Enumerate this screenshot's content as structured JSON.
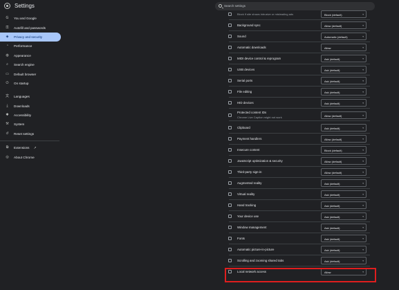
{
  "app": {
    "title": "Settings"
  },
  "search": {
    "placeholder": "Search settings"
  },
  "sidebar": {
    "items": [
      {
        "label": "You and Google",
        "icon": "google-icon"
      },
      {
        "label": "Autofill and passwords",
        "icon": "key-icon"
      },
      {
        "label": "Privacy and security",
        "icon": "shield-icon",
        "active": true
      },
      {
        "label": "Performance",
        "icon": "speedometer-icon"
      },
      {
        "label": "Appearance",
        "icon": "palette-icon"
      },
      {
        "label": "Search engine",
        "icon": "search-icon"
      },
      {
        "label": "Default browser",
        "icon": "browser-icon"
      },
      {
        "label": "On startup",
        "icon": "power-icon"
      },
      {
        "label": "Languages",
        "icon": "translate-icon"
      },
      {
        "label": "Downloads",
        "icon": "download-icon"
      },
      {
        "label": "Accessibility",
        "icon": "accessibility-icon"
      },
      {
        "label": "System",
        "icon": "wrench-icon"
      },
      {
        "label": "Reset settings",
        "icon": "reset-icon"
      },
      {
        "label": "Extensions",
        "icon": "puzzle-icon"
      },
      {
        "label": "About Chrome",
        "icon": "chrome-icon"
      }
    ]
  },
  "permissions": {
    "rows": [
      {
        "label": "",
        "sub": "Block if site shows intrusive or misleading ads",
        "value": "Block (default)",
        "icon": "ads-icon"
      },
      {
        "label": "Background sync",
        "value": "Allow (default)",
        "icon": "sync-icon"
      },
      {
        "label": "Sound",
        "value": "Automatic (default)",
        "icon": "speaker-icon"
      },
      {
        "label": "Automatic downloads",
        "value": "Allow",
        "icon": "download-icon"
      },
      {
        "label": "MIDI device control & reprogram",
        "value": "Ask (default)",
        "icon": "piano-icon"
      },
      {
        "label": "USB devices",
        "value": "Ask (default)",
        "icon": "usb-icon"
      },
      {
        "label": "Serial ports",
        "value": "Ask (default)",
        "icon": "serial-port-icon"
      },
      {
        "label": "File editing",
        "value": "Ask (default)",
        "icon": "file-icon"
      },
      {
        "label": "HID devices",
        "value": "Ask (default)",
        "icon": "hid-icon"
      },
      {
        "label": "Protected content IDs",
        "sub": "Chrome Live Caption might not work",
        "value": "Allow (default)",
        "icon": "protected-content-icon"
      },
      {
        "label": "Clipboard",
        "value": "Ask (default)",
        "icon": "clipboard-icon"
      },
      {
        "label": "Payment handlers",
        "value": "Allow (default)",
        "icon": "payment-icon"
      },
      {
        "label": "Insecure content",
        "value": "Block (default)",
        "icon": "warning-icon"
      },
      {
        "label": "JavaScript optimization & security",
        "value": "Allow (default)",
        "icon": "js-icon"
      },
      {
        "label": "Third-party sign-in",
        "value": "Allow (default)",
        "icon": "sign-in-icon"
      },
      {
        "label": "Augmented reality",
        "value": "Ask (default)",
        "icon": "ar-icon"
      },
      {
        "label": "Virtual reality",
        "value": "Ask (default)",
        "icon": "vr-icon"
      },
      {
        "label": "Hand tracking",
        "value": "Ask (default)",
        "icon": "hand-icon"
      },
      {
        "label": "Your device use",
        "value": "Ask (default)",
        "icon": "device-use-icon"
      },
      {
        "label": "Window management",
        "value": "Ask (default)",
        "icon": "window-icon"
      },
      {
        "label": "Fonts",
        "value": "Ask (default)",
        "icon": "font-icon"
      },
      {
        "label": "Automatic picture-in-picture",
        "value": "Ask (default)",
        "icon": "pip-icon"
      },
      {
        "label": "Scrolling and zooming shared tabs",
        "value": "Ask (default)",
        "icon": "scroll-icon"
      },
      {
        "label": "Local network access",
        "value": "Allow",
        "icon": "network-icon"
      }
    ]
  },
  "colors": {
    "accent": "#a8c7fa",
    "highlight": "#e01e1e",
    "background": "#202124"
  }
}
